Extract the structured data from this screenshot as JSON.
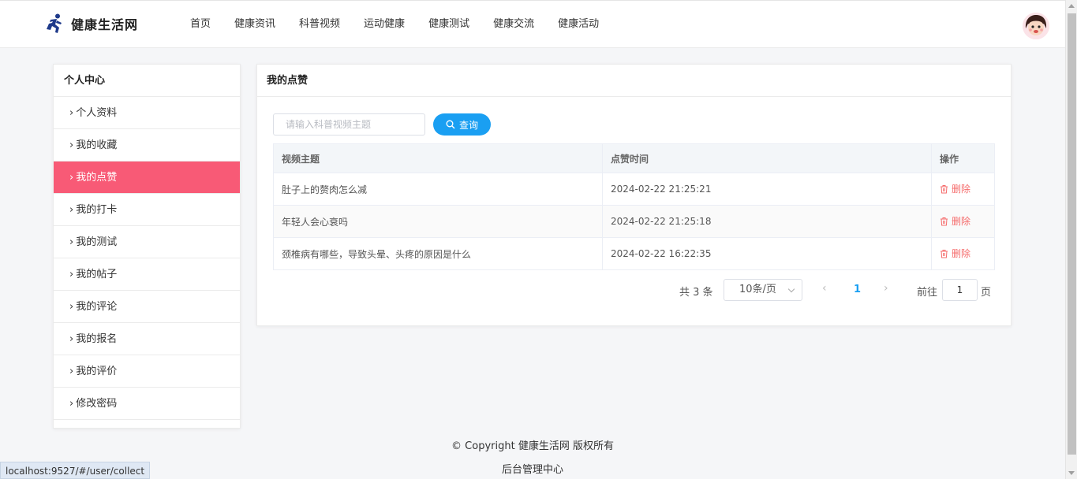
{
  "header": {
    "site_name": "健康生活网",
    "nav": [
      "首页",
      "健康资讯",
      "科普视频",
      "运动健康",
      "健康测试",
      "健康交流",
      "健康活动"
    ]
  },
  "sidebar": {
    "title": "个人中心",
    "items": [
      {
        "label": "个人资料"
      },
      {
        "label": "我的收藏"
      },
      {
        "label": "我的点赞"
      },
      {
        "label": "我的打卡"
      },
      {
        "label": "我的测试"
      },
      {
        "label": "我的帖子"
      },
      {
        "label": "我的评论"
      },
      {
        "label": "我的报名"
      },
      {
        "label": "我的评价"
      },
      {
        "label": "修改密码"
      }
    ],
    "active_index": 2
  },
  "panel": {
    "title": "我的点赞",
    "search_placeholder": "请输入科普视频主题",
    "search_button": "查询",
    "columns": [
      "视频主题",
      "点赞时间",
      "操作"
    ],
    "rows": [
      {
        "topic": "肚子上的赘肉怎么减",
        "time": "2024-02-22 21:25:21",
        "action": "删除"
      },
      {
        "topic": "年轻人会心衰吗",
        "time": "2024-02-22 21:25:18",
        "action": "删除"
      },
      {
        "topic": "颈椎病有哪些，导致头晕、头疼的原因是什么",
        "time": "2024-02-22 16:22:35",
        "action": "删除"
      }
    ]
  },
  "pagination": {
    "total": "共 3 条",
    "page_size": "10条/页",
    "current_page": "1",
    "goto_label": "前往",
    "goto_value": "1",
    "goto_suffix": "页"
  },
  "footer": {
    "copyright": "© Copyright 健康生活网 版权所有",
    "admin_link": "后台管理中心"
  },
  "status_url": "localhost:9527/#/user/collect",
  "colors": {
    "accent": "#1a9ff2",
    "active_menu": "#f85a76",
    "delete": "#f56c6c"
  }
}
